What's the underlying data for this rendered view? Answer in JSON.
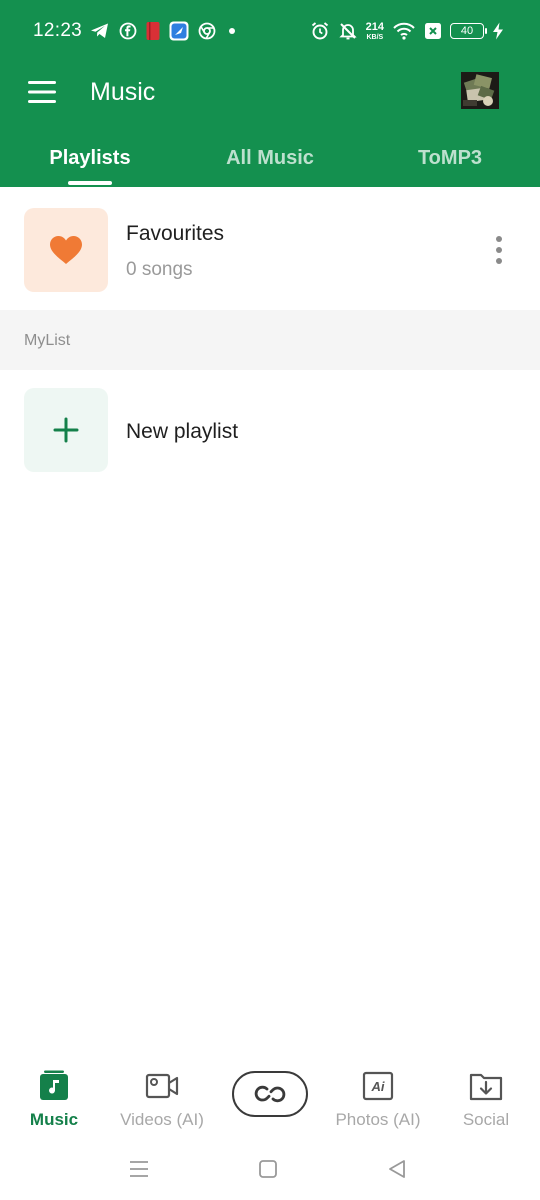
{
  "status_bar": {
    "time": "12:23",
    "left_icons": [
      "telegram-icon",
      "facebook-icon",
      "red-app-icon",
      "blue-app-icon",
      "chrome-icon",
      "dot-icon"
    ],
    "right_icons": [
      "alarm-icon",
      "mute-icon",
      "wifi-icon",
      "sim-off-icon",
      "charging-icon"
    ],
    "network_speed": "214",
    "network_unit": "KB/S",
    "battery": "40"
  },
  "app_bar": {
    "title": "Music"
  },
  "tabs": [
    {
      "label": "Playlists",
      "active": true
    },
    {
      "label": "All Music",
      "active": false
    },
    {
      "label": "ToMP3",
      "active": false
    }
  ],
  "favourites": {
    "title": "Favourites",
    "subtitle": "0 songs",
    "icon": "heart-icon"
  },
  "section": {
    "label": "MyList"
  },
  "new_playlist": {
    "label": "New playlist",
    "icon": "plus-icon"
  },
  "bottom_nav": [
    {
      "label": "Music",
      "icon": "music-note-icon",
      "active": true
    },
    {
      "label": "Videos (AI)",
      "icon": "video-camera-icon",
      "active": false
    },
    {
      "label": "",
      "icon": "link-icon",
      "active": false
    },
    {
      "label": "Photos (AI)",
      "icon": "ai-photo-icon",
      "active": false
    },
    {
      "label": "Social",
      "icon": "download-folder-icon",
      "active": false
    }
  ],
  "colors": {
    "brand_green": "#14904f",
    "active_nav": "#14804a",
    "heart": "#f07a35",
    "favourites_bg": "#fde9dc",
    "new_playlist_bg": "#eef7f3"
  }
}
